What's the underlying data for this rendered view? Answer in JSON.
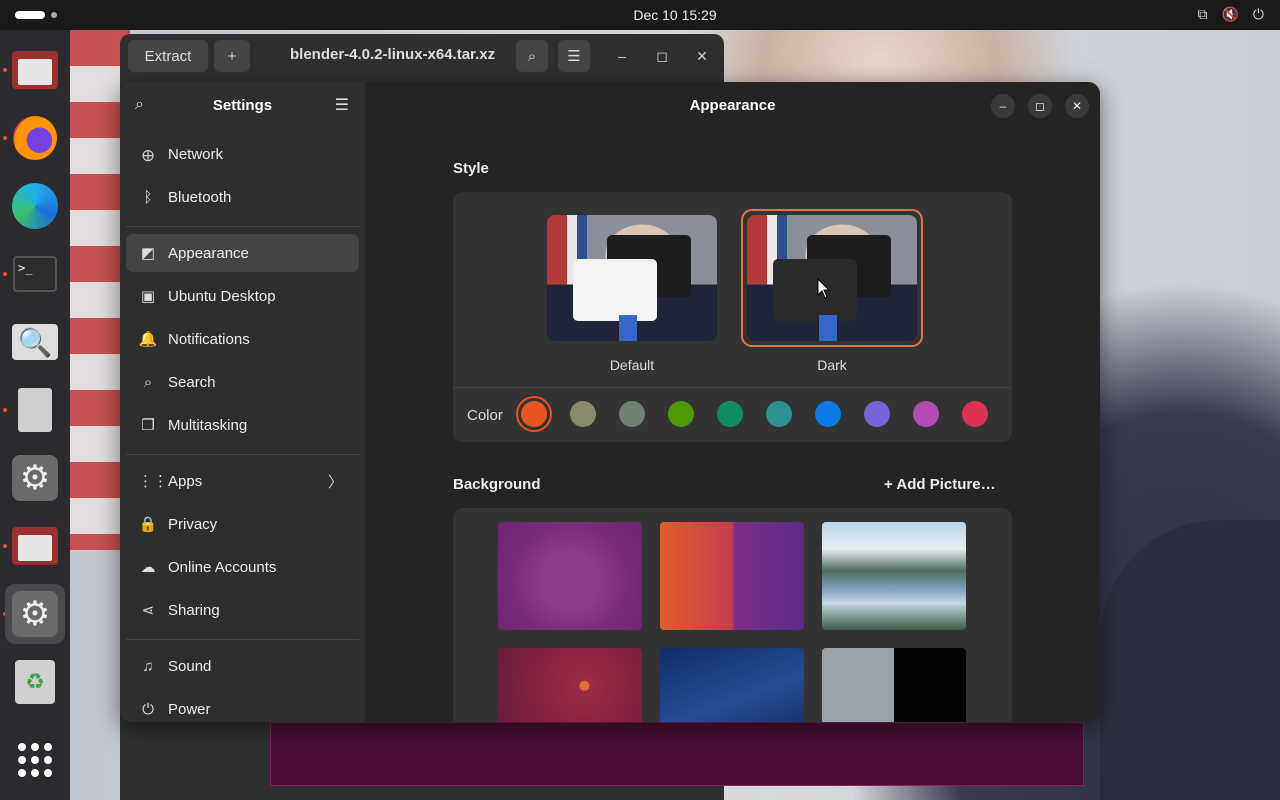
{
  "topbar": {
    "clock": "Dec 10  15:29",
    "tray_network": "⧉",
    "tray_volume": "🔇",
    "tray_power": "⏻"
  },
  "dock": {
    "items": [
      {
        "name": "files-icon"
      },
      {
        "name": "firefox-icon"
      },
      {
        "name": "edge-icon"
      },
      {
        "name": "terminal-icon",
        "glyph": ">_"
      },
      {
        "name": "image-viewer-icon",
        "glyph": "🔍"
      },
      {
        "name": "archive-manager-icon"
      },
      {
        "name": "settings-app-icon",
        "glyph": "⚙"
      },
      {
        "name": "files-icon-2"
      },
      {
        "name": "settings-running-icon",
        "glyph": "⚙"
      },
      {
        "name": "trash-icon",
        "glyph": "♻"
      },
      {
        "name": "show-apps-icon"
      }
    ]
  },
  "archive": {
    "extract_label": "Extract",
    "add_label": "+",
    "title": "blender-4.0.2-linux-x64.tar.xz",
    "search_glyph": "⌕",
    "menu_glyph": "☰",
    "minimize_glyph": "–",
    "maximize_glyph": "◻",
    "close_glyph": "✕"
  },
  "settings": {
    "sidebar_title": "Settings",
    "search_glyph": "⌕",
    "menu_glyph": "☰",
    "items": [
      {
        "label": "Network",
        "icon": "🜨"
      },
      {
        "label": "Bluetooth",
        "icon": "ᛒ"
      },
      {
        "label": "Appearance",
        "icon": "◩"
      },
      {
        "label": "Ubuntu Desktop",
        "icon": "▣"
      },
      {
        "label": "Notifications",
        "icon": "🔔"
      },
      {
        "label": "Search",
        "icon": "⌕"
      },
      {
        "label": "Multitasking",
        "icon": "❐"
      },
      {
        "label": "Apps",
        "icon": "⋮⋮"
      },
      {
        "label": "Privacy",
        "icon": "🔒"
      },
      {
        "label": "Online Accounts",
        "icon": "☁"
      },
      {
        "label": "Sharing",
        "icon": "⋖"
      },
      {
        "label": "Sound",
        "icon": "♫"
      },
      {
        "label": "Power",
        "icon": "⏻"
      }
    ],
    "apps_chevron": "〉",
    "page_title": "Appearance",
    "minimize_glyph": "–",
    "maximize_glyph": "◻",
    "close_glyph": "✕",
    "style": {
      "label": "Style",
      "default_caption": "Default",
      "dark_caption": "Dark",
      "selected": "Dark"
    },
    "color": {
      "label": "Color",
      "selected": 0,
      "swatches": [
        "#e95420",
        "#8b8a68",
        "#6f8373",
        "#4e9a06",
        "#0f8c63",
        "#2c9193",
        "#0a7ae6",
        "#7764d8",
        "#b34cb3",
        "#da3450"
      ]
    },
    "background": {
      "label": "Background",
      "add_picture_label": "Add Picture…",
      "add_picture_glyph": "+"
    }
  }
}
